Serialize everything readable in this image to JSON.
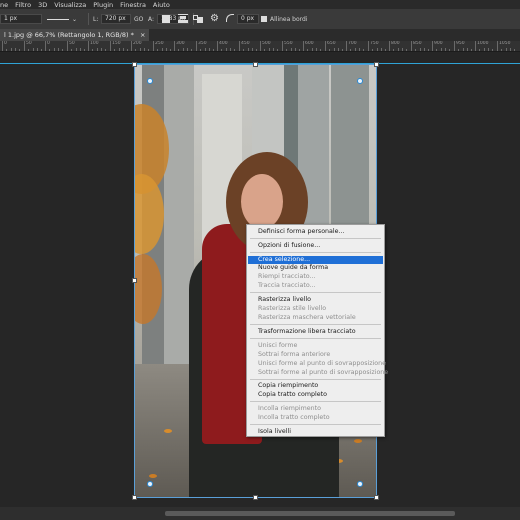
{
  "menubar": [
    "ne",
    "Filtro",
    "3D",
    "Visualizza",
    "Plugin",
    "Finestra",
    "Aiuto"
  ],
  "options": {
    "stroke_width": "1 px",
    "width_label": "L:",
    "width_value": "720 px",
    "link_icon": "GO",
    "height_label": "A:",
    "height_value": "1283 px",
    "radius_value": "0 px",
    "align_edges": "Allinea bordi"
  },
  "document_tab": {
    "title": "l 1.jpg @ 66,7% (Rettangolo 1, RGB/8) *",
    "close": "×"
  },
  "ruler_labels": [
    "0",
    "50",
    "0",
    "50",
    "100",
    "150",
    "200",
    "250",
    "300",
    "350",
    "400",
    "450",
    "500",
    "550",
    "600",
    "650",
    "700",
    "750",
    "800",
    "850",
    "900",
    "950",
    "1000",
    "1050"
  ],
  "context_menu": {
    "items": [
      {
        "label": "Definisci forma personale...",
        "enabled": true
      },
      {
        "label": "Opzioni di fusione...",
        "enabled": true
      },
      {
        "label": "Crea selezione...",
        "enabled": true,
        "highlighted": true
      },
      {
        "label": "Nuove guide da forma",
        "enabled": true
      },
      {
        "label": "Riempi tracciato...",
        "enabled": false
      },
      {
        "label": "Traccia tracciato...",
        "enabled": false
      },
      {
        "label": "Rasterizza livello",
        "enabled": true
      },
      {
        "label": "Rasterizza stile livello",
        "enabled": false
      },
      {
        "label": "Rasterizza maschera vettoriale",
        "enabled": false
      },
      {
        "label": "Trasformazione libera tracciato",
        "enabled": true
      },
      {
        "label": "Unisci forme",
        "enabled": false
      },
      {
        "label": "Sottrai forma anteriore",
        "enabled": false
      },
      {
        "label": "Unisci forme al punto di sovrapposizione",
        "enabled": false
      },
      {
        "label": "Sottrai forme al punto di sovrapposizione",
        "enabled": false
      },
      {
        "label": "Copia riempimento",
        "enabled": true
      },
      {
        "label": "Copia tratto completo",
        "enabled": true
      },
      {
        "label": "Incolla riempimento",
        "enabled": false
      },
      {
        "label": "Incolla tratto completo",
        "enabled": false
      },
      {
        "label": "Isola livelli",
        "enabled": true
      }
    ]
  },
  "colors": {
    "highlight": "#1f6fd6",
    "guide": "#2fa3d6",
    "coat": "#9b1c1e"
  }
}
